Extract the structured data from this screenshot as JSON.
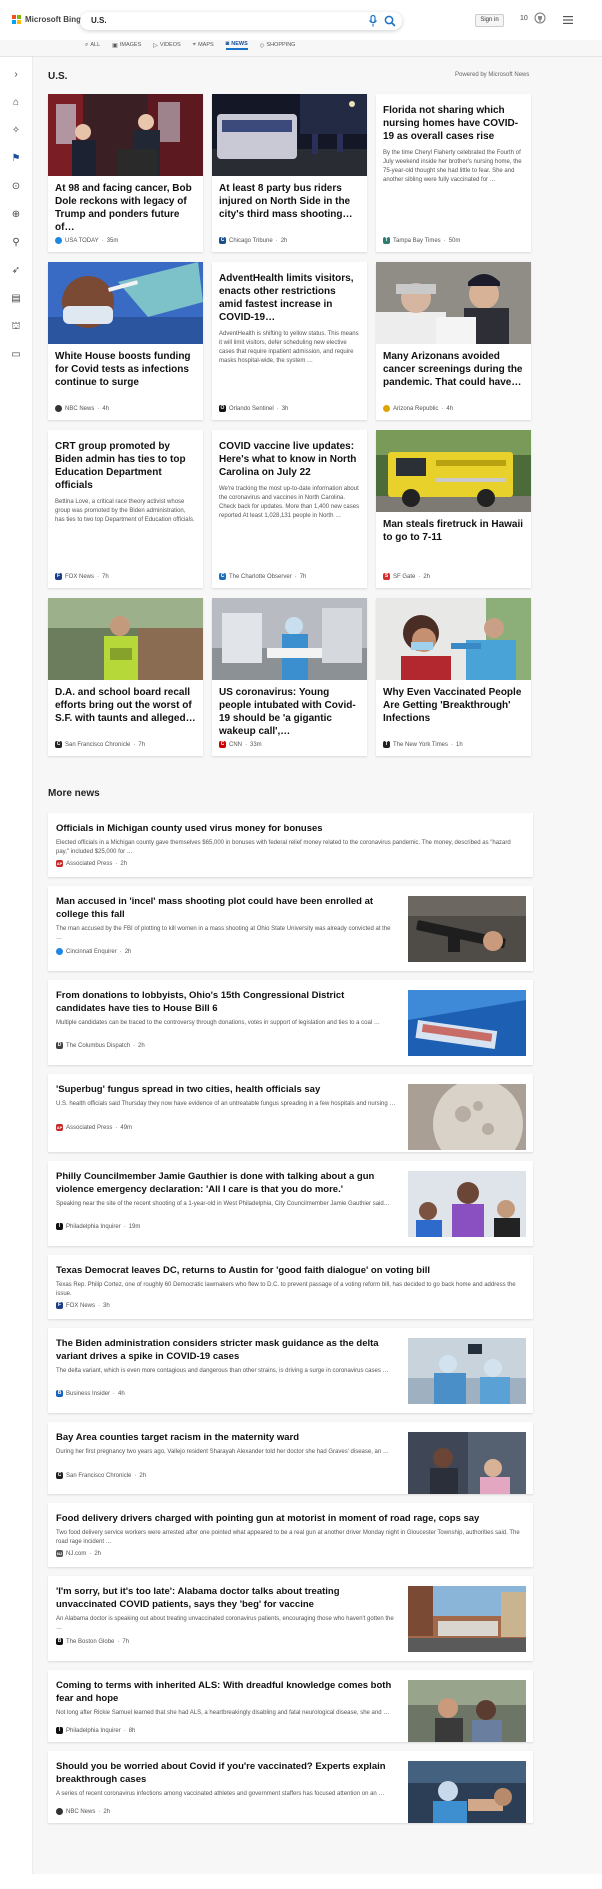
{
  "header": {
    "logo_text": "Microsoft Bing",
    "query": "U.S.",
    "signin": "Sign in",
    "rewards_count": "10"
  },
  "tabs": [
    {
      "label": "ALL"
    },
    {
      "label": "IMAGES"
    },
    {
      "label": "VIDEOS"
    },
    {
      "label": "MAPS"
    },
    {
      "label": "NEWS"
    },
    {
      "label": "SHOPPING"
    }
  ],
  "section": {
    "title": "U.S.",
    "powered": "Powered by Microsoft News",
    "more_title": "More news"
  },
  "cards": [
    {
      "title": "At 98 and facing cancer, Bob Dole reckons with legacy of Trump and ponders future of…",
      "source": "USA TODAY",
      "time": "35m",
      "src_color": "#1e88e5",
      "src_letter": ""
    },
    {
      "title": "At least 8 party bus riders injured on North Side in the city's third mass shooting…",
      "source": "Chicago Tribune",
      "time": "2h",
      "src_color": "#1b4f8a",
      "src_letter": "C"
    },
    {
      "title": "Florida not sharing which nursing homes have COVID-19 as overall cases rise",
      "snippet": "By the time Cheryl Flaherty celebrated the Fourth of July weekend inside her brother's nursing home, the 75-year-old thought she had little to fear. She and another sibling were fully vaccinated for …",
      "source": "Tampa Bay Times",
      "time": "50m",
      "src_color": "#2e7d6e",
      "src_letter": "T"
    },
    {
      "title": "White House boosts funding for Covid tests as infections continue to surge",
      "source": "NBC News",
      "time": "4h",
      "src_color": "#333",
      "src_letter": ""
    },
    {
      "title": "AdventHealth limits visitors, enacts other restrictions amid fastest increase in COVID-19…",
      "snippet": "AdventHealth is shifting to yellow status. This means it will limit visitors, defer scheduling new elective cases that require inpatient admission, and require masks hospital-wide, the system …",
      "source": "Orlando Sentinel",
      "time": "3h",
      "src_color": "#111",
      "src_letter": "O"
    },
    {
      "title": "Many Arizonans avoided cancer screenings during the pandemic. That could have…",
      "source": "Arizona Republic",
      "time": "4h",
      "src_color": "#e0a400",
      "src_letter": ""
    },
    {
      "title": "CRT group promoted by Biden admin has ties to top Education Department officials",
      "snippet": "Bettina Love, a critical race theory activist whose group was promoted by the Biden administration, has ties to two top Department of Education officials.",
      "source": "FOX News",
      "time": "7h",
      "src_color": "#1d3f8a",
      "src_letter": "F"
    },
    {
      "title": "COVID vaccine live updates: Here's what to know in North Carolina on July 22",
      "snippet": "We're tracking the most up-to-date information about the coronavirus and vaccines in North Carolina. Check back for updates. More than 1,400 new cases reported At least 1,028,131 people in North …",
      "source": "The Charlotte Observer",
      "time": "7h",
      "src_color": "#1e6fb8",
      "src_letter": "C"
    },
    {
      "title": "Man steals firetruck in Hawaii to go to 7-11",
      "source": "SF Gate",
      "time": "2h",
      "src_color": "#d32f2f",
      "src_letter": "S"
    },
    {
      "title": "D.A. and school board recall efforts bring out the worst of S.F. with taunts and alleged…",
      "source": "San Francisco Chronicle",
      "time": "7h",
      "src_color": "#222",
      "src_letter": "C"
    },
    {
      "title": "US coronavirus: Young people intubated with Covid-19 should be 'a gigantic wakeup call',…",
      "source": "CNN",
      "time": "33m",
      "src_color": "#cc0000",
      "src_letter": "C"
    },
    {
      "title": "Why Even Vaccinated People Are Getting 'Breakthrough' Infections",
      "source": "The New York Times",
      "time": "1h",
      "src_color": "#222",
      "src_letter": "T"
    }
  ],
  "more_news": [
    {
      "title": "Officials in Michigan county used virus money for bonuses",
      "snippet": "Elected officials in a Michigan county gave themselves $65,000 in bonuses with federal relief money related to the coronavirus pandemic. The money, described as \"hazard pay,\" included $25,000 for …",
      "source": "Associated Press",
      "time": "2h",
      "src_color": "#c62828",
      "src_letter": "AP"
    },
    {
      "title": "Man accused in 'incel' mass shooting plot could have been enrolled at college this fall",
      "snippet": "The man accused by the FBI of plotting to kill women in a mass shooting at Ohio State University was already convicted at the …",
      "source": "Cincinnati Enquirer",
      "time": "2h",
      "src_color": "#1e88e5",
      "src_letter": ""
    },
    {
      "title": "From donations to lobbyists, Ohio's 15th Congressional District candidates have ties to House Bill 6",
      "snippet": "Multiple candidates can be traced to the controversy through donations, votes in support of legislation and ties to a coal …",
      "source": "The Columbus Dispatch",
      "time": "2h",
      "src_color": "#444",
      "src_letter": "D"
    },
    {
      "title": "'Superbug' fungus spread in two cities, health officials say",
      "snippet": "U.S. health officials said Thursday they now have evidence of an untreatable fungus spreading in a few hospitals and nursing …",
      "source": "Associated Press",
      "time": "49m",
      "src_color": "#c62828",
      "src_letter": "AP"
    },
    {
      "title": "Philly Councilmember Jamie Gauthier is done with talking about a gun violence emergency declaration: 'All I care is that you do more.'",
      "snippet": "Speaking near the site of the recent shooting of a 1-year-old in West Philadelphia, City Councilmember Jamie Gauthier said…",
      "source": "Philadelphia Inquirer",
      "time": "19m",
      "src_color": "#111",
      "src_letter": "I"
    },
    {
      "title": "Texas Democrat leaves DC, returns to Austin for 'good faith dialogue' on voting bill",
      "snippet": "Texas Rep. Philip Cortez, one of roughly 60 Democratic lawmakers who flew to D.C. to prevent passage of a voting reform bill, has decided to go back home and address the issue.",
      "source": "FOX News",
      "time": "3h",
      "src_color": "#1d3f8a",
      "src_letter": "F"
    },
    {
      "title": "The Biden administration considers stricter mask guidance as the delta variant drives a spike in COVID-19 cases",
      "snippet": "The delta variant, which is even more contagious and dangerous than other strains, is driving a surge in coronavirus cases …",
      "source": "Business Insider",
      "time": "4h",
      "src_color": "#1565c0",
      "src_letter": "B"
    },
    {
      "title": "Bay Area counties target racism in the maternity ward",
      "snippet": "During her first pregnancy two years ago, Vallejo resident Sharayah Alexander told her doctor she had Graves' disease, an …",
      "source": "San Francisco Chronicle",
      "time": "2h",
      "src_color": "#222",
      "src_letter": "C"
    },
    {
      "title": "Food delivery drivers charged with pointing gun at motorist in moment of road rage, cops say",
      "snippet": "Two food delivery service workers were arrested after one pointed what appeared to be a real gun at another driver Monday night in Gloucester Township, authorities said. The road rage incident …",
      "source": "NJ.com",
      "time": "2h",
      "src_color": "#555",
      "src_letter": "NJ"
    },
    {
      "title": "'I'm sorry, but it's too late': Alabama doctor talks about treating unvaccinated COVID patients, says they 'beg' for vaccine",
      "snippet": "An Alabama doctor is speaking out about treating unvaccinated coronavirus patients, encouraging those who haven't gotten the …",
      "source": "The Boston Globe",
      "time": "7h",
      "src_color": "#111",
      "src_letter": "B"
    },
    {
      "title": "Coming to terms with inherited ALS: With dreadful knowledge comes both fear and hope",
      "snippet": "Not long after Rickie Samuel learned that she had ALS, a heartbreakingly disabling and fatal neurological disease, she and …",
      "source": "Philadelphia Inquirer",
      "time": "8h",
      "src_color": "#111",
      "src_letter": "I"
    },
    {
      "title": "Should you be worried about Covid if you're vaccinated? Experts explain breakthrough cases",
      "snippet": "A series of recent coronavirus infections among vaccinated athletes and government staffers has focused attention on an …",
      "source": "NBC News",
      "time": "2h",
      "src_color": "#333",
      "src_letter": ""
    }
  ],
  "icons": {
    "search": "magnifier-icon",
    "mic": "microphone-icon",
    "menu": "hamburger-menu-icon",
    "rewards": "trophy-icon"
  },
  "colors": {
    "accent": "#1a73c9",
    "bg": "#f7f7f7"
  }
}
